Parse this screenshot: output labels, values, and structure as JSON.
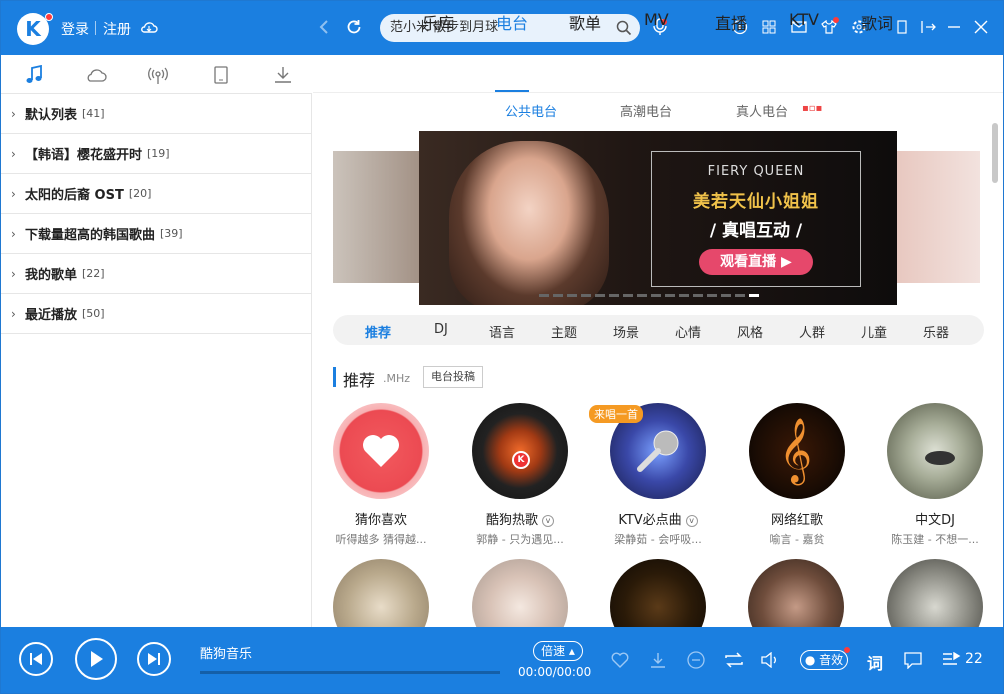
{
  "topbar": {
    "login": "登录",
    "register": "注册",
    "search_placeholder": "范小米 散步到月球"
  },
  "sidebar": {
    "items": [
      {
        "name": "默认列表",
        "count": "[41]"
      },
      {
        "name": "【韩语】樱花盛开时",
        "count": "[19]"
      },
      {
        "name": "太阳的后裔 OST",
        "count": "[20]"
      },
      {
        "name": "下载量超高的韩国歌曲",
        "count": "[39]"
      },
      {
        "name": "我的歌单",
        "count": "[22]"
      },
      {
        "name": "最近播放",
        "count": "[50]"
      }
    ]
  },
  "nav": {
    "tabs": [
      "乐库",
      "电台",
      "歌单",
      "MV",
      "直播",
      "KTV",
      "歌词"
    ],
    "active": "电台"
  },
  "subnav": {
    "tabs": [
      "公共电台",
      "高潮电台",
      "真人电台"
    ],
    "active": "公共电台"
  },
  "banner": {
    "en": "FIERY QUEEN",
    "line1": "美若天仙小姐姐",
    "line2": "/ 真唱互动 /",
    "button": "观看直播"
  },
  "categories": {
    "items": [
      "推荐",
      "DJ",
      "语言",
      "主题",
      "场景",
      "心情",
      "风格",
      "人群",
      "儿童",
      "乐器"
    ],
    "active": "推荐"
  },
  "section": {
    "title": "推荐",
    "sub": ".MHz",
    "button": "电台投稿"
  },
  "stations": [
    {
      "title": "猜你喜欢",
      "sub": "听得越多 猜得越..."
    },
    {
      "title": "酷狗热歌",
      "sub": "郭静 - 只为遇见..."
    },
    {
      "title": "KTV必点曲",
      "sub": "梁静茹 - 会呼吸...",
      "badge": "来唱一首"
    },
    {
      "title": "网络红歌",
      "sub": "喻言 - 嘉贫"
    },
    {
      "title": "中文DJ",
      "sub": "陈玉建 - 不想一..."
    }
  ],
  "player": {
    "song": "酷狗音乐",
    "speed": "倍速",
    "time": "00:00/00:00",
    "effect": "音效",
    "lyric": "词",
    "queue_count": "22"
  }
}
